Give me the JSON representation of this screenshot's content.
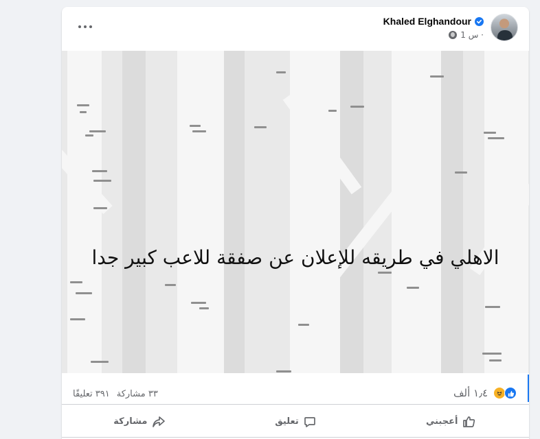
{
  "post": {
    "author": "Khaled Elghandour",
    "time": "1 س ·",
    "text": "الاهلي في طريقه للإعلان عن صفقة للاعب كبير جدا"
  },
  "icons": {
    "more": "more-options-icon",
    "verified": "verified-badge-icon",
    "privacy": "globe-icon",
    "like_reaction": "like-reaction-icon",
    "haha_reaction": "haha-reaction-icon",
    "like_action": "thumbs-up-icon",
    "comment_action": "comment-icon",
    "share_action": "share-icon"
  },
  "stats": {
    "reactions_count": "١٫٤ ألف",
    "comments": "٣٩١ تعليقًا",
    "shares": "٣٣ مشاركة"
  },
  "actions": {
    "like": "أعجبني",
    "comment": "تعليق",
    "share": "مشاركة"
  },
  "colors": {
    "accent": "#1877f2",
    "secondary_text": "#65676b",
    "background": "#f0f2f5"
  }
}
